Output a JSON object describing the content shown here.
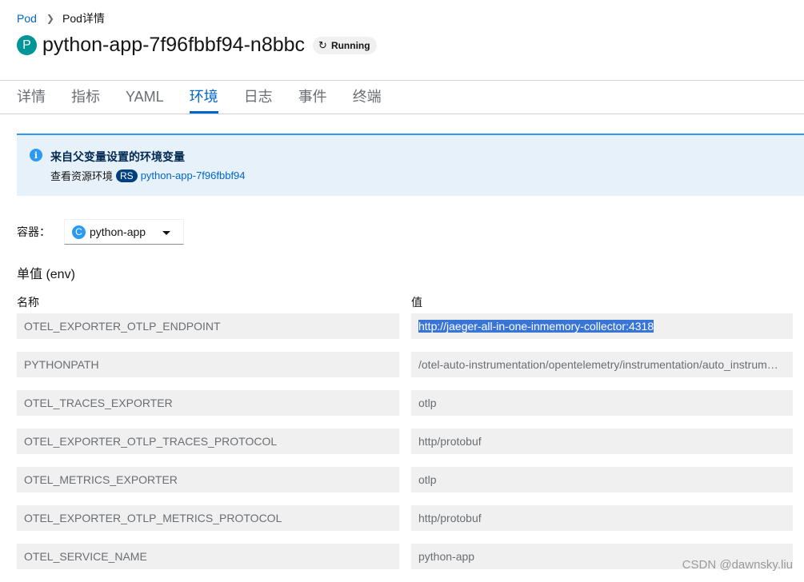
{
  "breadcrumb": {
    "parent": "Pod",
    "current": "Pod详情"
  },
  "header": {
    "badge": "P",
    "title": "python-app-7f96fbbf94-n8bbc",
    "status": "Running"
  },
  "tabs": [
    {
      "label": "详情"
    },
    {
      "label": "指标"
    },
    {
      "label": "YAML"
    },
    {
      "label": "环境"
    },
    {
      "label": "日志"
    },
    {
      "label": "事件"
    },
    {
      "label": "终端"
    }
  ],
  "active_tab": "环境",
  "alert": {
    "title": "来自父变量设置的环境变量",
    "body_prefix": "查看资源环境",
    "rs_badge": "RS",
    "link": "python-app-7f96fbbf94"
  },
  "container": {
    "label": "容器：",
    "badge": "C",
    "selected": "python-app"
  },
  "section": {
    "title": "单值 (env)",
    "name_header": "名称",
    "value_header": "值"
  },
  "env": [
    {
      "name": "OTEL_EXPORTER_OTLP_ENDPOINT",
      "value": "http://jaeger-all-in-one-inmemory-collector:4318"
    },
    {
      "name": "PYTHONPATH",
      "value": "/otel-auto-instrumentation/opentelemetry/instrumentation/auto_instrumentation"
    },
    {
      "name": "OTEL_TRACES_EXPORTER",
      "value": "otlp"
    },
    {
      "name": "OTEL_EXPORTER_OTLP_TRACES_PROTOCOL",
      "value": "http/protobuf"
    },
    {
      "name": "OTEL_METRICS_EXPORTER",
      "value": "otlp"
    },
    {
      "name": "OTEL_EXPORTER_OTLP_METRICS_PROTOCOL",
      "value": "http/protobuf"
    },
    {
      "name": "OTEL_SERVICE_NAME",
      "value": "python-app"
    }
  ],
  "watermark": "CSDN @dawnsky.liu",
  "colors": {
    "link": "#0066cc",
    "pod_badge": "#009596",
    "alert_bg": "#e7f1fa",
    "alert_accent": "#2b9af3",
    "selection": "#3875d7"
  }
}
